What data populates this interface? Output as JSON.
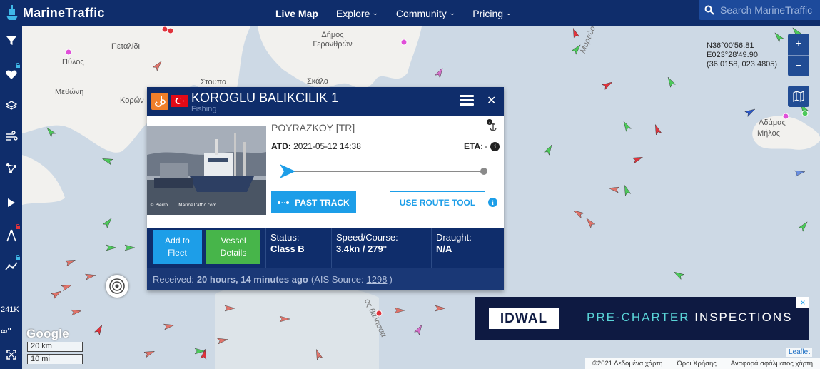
{
  "app": {
    "name": "MarineTraffic"
  },
  "nav": {
    "items": [
      {
        "label": "Live Map",
        "active": true,
        "dropdown": false
      },
      {
        "label": "Explore",
        "active": false,
        "dropdown": true
      },
      {
        "label": "Community",
        "active": false,
        "dropdown": true
      },
      {
        "label": "Pricing",
        "active": false,
        "dropdown": true
      }
    ],
    "search_placeholder": "Search MarineTraffic"
  },
  "sidebar": {
    "buttons": [
      "filter-icon",
      "heart-icon",
      "layers-icon",
      "wind-icon",
      "share-network-icon",
      "play-icon",
      "compass-measure-icon",
      "route-chart-icon"
    ],
    "count_label": "241K",
    "infinity_label": "∞\"",
    "expand_icon": "expand-icon"
  },
  "map": {
    "place_labels": [
      "Πεταλίδι",
      "Δήμος Γερονθρών",
      "Πύλος",
      "Στουπα",
      "Σκάλα",
      "Μεθώνη",
      "Κορών",
      "Μυρτώο Πέλαγο",
      "Αδάμας",
      "Μήλος",
      "ος θάλασσα"
    ],
    "coordinates": {
      "lat": "N36°00'56.81",
      "lon": "E023°28'49.90",
      "decimal": "(36.0158, 023.4805)"
    },
    "zoom_in": "+",
    "zoom_out": "−",
    "google_label": "Google",
    "scale": {
      "km": "20 km",
      "mi": "10 mi"
    },
    "leaflet": "Leaflet",
    "attribution": [
      "©2021 Δεδομένα χάρτη",
      "Όροι Χρήσης",
      "Αναφορά σφάλματος χάρτη"
    ]
  },
  "vessel": {
    "name": "KOROGLU BALIKCILIK 1",
    "type": "Fishing",
    "destination": "POYRAZKOY [TR]",
    "atd_label": "ATD:",
    "atd_value": "2021-05-12 14:38",
    "eta_label": "ETA:",
    "eta_value": "-",
    "photo_caption": "© Pierro....... MarineTraffic.com",
    "past_track_label": "PAST TRACK",
    "route_tool_label": "USE ROUTE TOOL",
    "add_fleet_label": "Add to Fleet",
    "vessel_details_label": "Vessel Details",
    "status_label": "Status:",
    "status_value": "Class B",
    "speed_label": "Speed/Course:",
    "speed_value": "3.4kn / 279°",
    "draught_label": "Draught:",
    "draught_value": "N/A",
    "received_prefix": "Received:",
    "received_value": "20 hours, 14 minutes ago",
    "ais_prefix": "(AIS Source:",
    "ais_source": "1298",
    "ais_suffix": ")"
  },
  "ad": {
    "logo": "IDWAL",
    "text_a": "PRE-CHARTER",
    "text_b": "INSPECTIONS",
    "close": "×"
  },
  "colors": {
    "nav_bg": "#0f2d6b",
    "accent_blue": "#1d9ee8",
    "green_button": "#47b54a",
    "sea": "#cdd9e5"
  }
}
